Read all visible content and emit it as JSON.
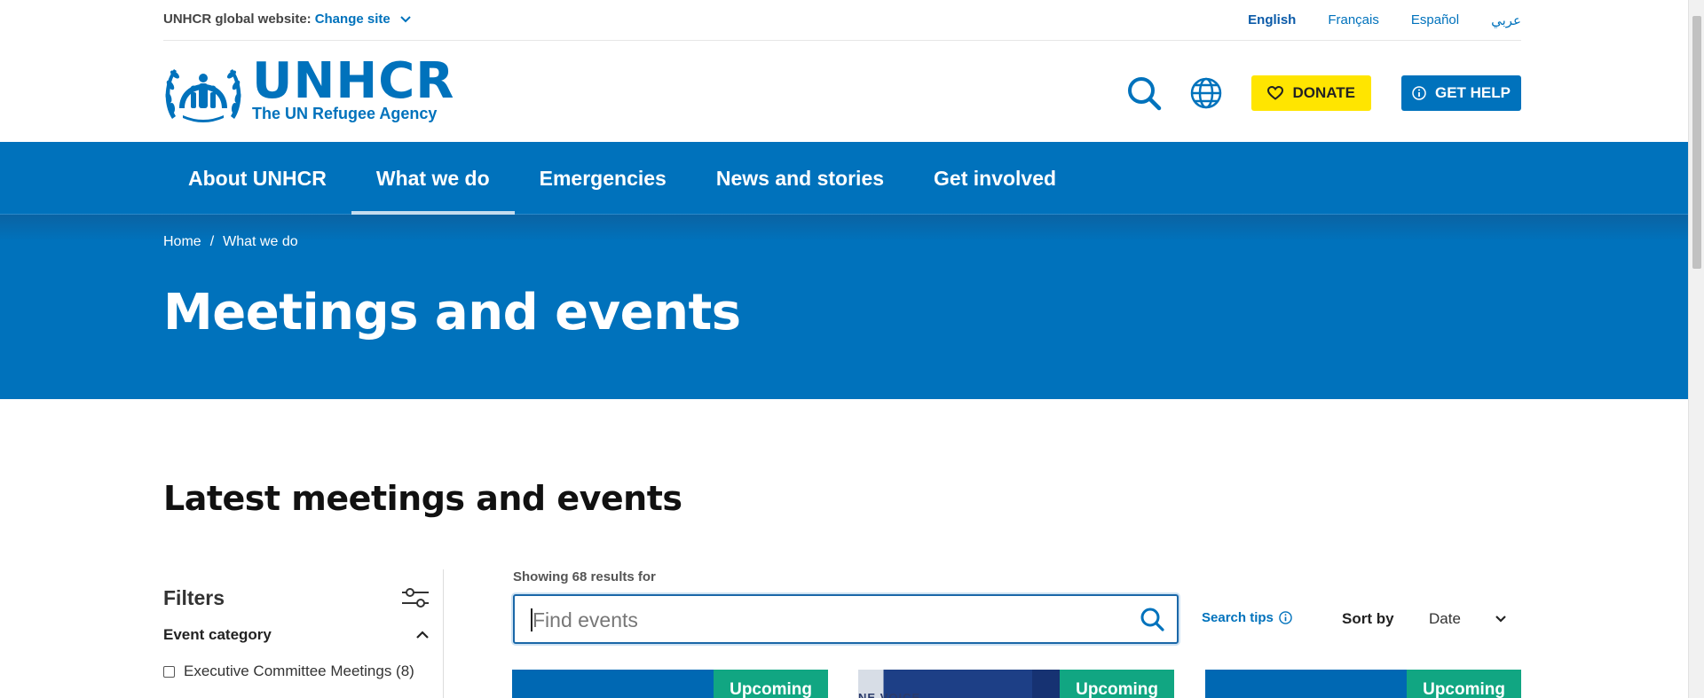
{
  "utility": {
    "global_label": "UNHCR global website:",
    "change_site": "Change site",
    "languages": [
      "English",
      "Français",
      "Español",
      "عربي"
    ]
  },
  "header": {
    "logo_title": "UNHCR",
    "logo_subtitle": "The UN Refugee Agency",
    "donate_label": "DONATE",
    "help_label": "GET HELP"
  },
  "nav": {
    "items": [
      "About UNHCR",
      "What we do",
      "Emergencies",
      "News and stories",
      "Get involved"
    ],
    "active": "What we do"
  },
  "breadcrumb": {
    "home": "Home",
    "separator": "/",
    "current": "What we do"
  },
  "hero": {
    "title": "Meetings and events"
  },
  "main": {
    "section_title": "Latest meetings and events",
    "filters_title": "Filters",
    "event_category": "Event category",
    "filter_option": "Executive Committee Meetings (8)",
    "showing": "Showing 68 results for",
    "search_placeholder": "Find events",
    "search_tips": "Search tips",
    "sort_by": "Sort by",
    "sort_value": "Date",
    "cards": [
      {
        "badge": "Upcoming"
      },
      {
        "badge": "Upcoming",
        "image_text": "NE VOICE"
      },
      {
        "badge": "Upcoming"
      }
    ]
  },
  "colors": {
    "brand_blue": "#0072bc",
    "donate_yellow": "#ffe500",
    "badge_green": "#11a682"
  }
}
